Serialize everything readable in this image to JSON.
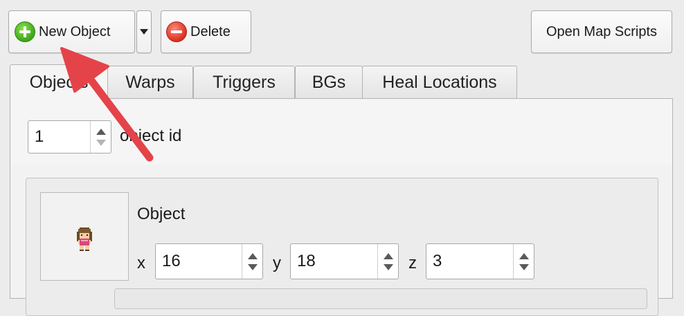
{
  "toolbar": {
    "new_object_label": "New Object",
    "new_object_icon": "plus-circle-icon",
    "delete_label": "Delete",
    "delete_icon": "minus-circle-icon",
    "open_map_scripts_label": "Open Map Scripts"
  },
  "tabs": [
    {
      "label": "Objects",
      "active": true
    },
    {
      "label": "Warps",
      "active": false
    },
    {
      "label": "Triggers",
      "active": false
    },
    {
      "label": "BGs",
      "active": false
    },
    {
      "label": "Heal Locations",
      "active": false
    }
  ],
  "objects_tab": {
    "object_id_value": "1",
    "object_id_label": "object id",
    "object": {
      "title": "Object",
      "sprite": "npc-girl-sprite-icon",
      "x_label": "x",
      "x_value": "16",
      "y_label": "y",
      "y_value": "18",
      "z_label": "z",
      "z_value": "3"
    }
  },
  "annotation": {
    "arrow_color": "#e5434a",
    "points_to": "New Object button"
  },
  "colors": {
    "plus_green": "#3ea51a",
    "minus_red": "#d8301f",
    "window_bg": "#ececec"
  }
}
